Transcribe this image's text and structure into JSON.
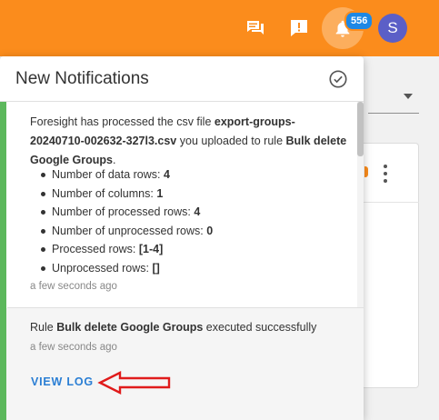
{
  "topbar": {
    "color": "#fb8c1c",
    "icons": [
      "feedback-icon",
      "report-icon",
      "bell-icon"
    ],
    "notification_count": "556",
    "avatar_initial": "S"
  },
  "panel": {
    "title": "New Notifications",
    "notifications": [
      {
        "text_pre": "Foresight has processed the csv file ",
        "file": "export-groups-20240710-002632-327l3.csv",
        "text_mid": " you uploaded to rule ",
        "rule": "Bulk delete Google Groups",
        "text_end": ".",
        "stats": [
          {
            "label": "Number of data rows: ",
            "value": "4"
          },
          {
            "label": "Number of columns: ",
            "value": "1"
          },
          {
            "label": "Number of processed rows: ",
            "value": "4"
          },
          {
            "label": "Number of unprocessed rows: ",
            "value": "0"
          },
          {
            "label": "Processed rows: ",
            "value": "[1-4]"
          },
          {
            "label": "Unprocessed rows: ",
            "value": "[]"
          }
        ],
        "time": "a few seconds ago"
      },
      {
        "text_pre": "Rule ",
        "rule": "Bulk delete Google Groups",
        "text_end": " executed successfully",
        "time": "a few seconds ago",
        "action": "VIEW LOG"
      }
    ]
  },
  "colors": {
    "accent_green": "#5cb85c",
    "link_blue": "#2a7ed4",
    "badge_blue": "#1e88e5",
    "avatar": "#5b5fc7",
    "annotation_red": "#e01b1b"
  }
}
